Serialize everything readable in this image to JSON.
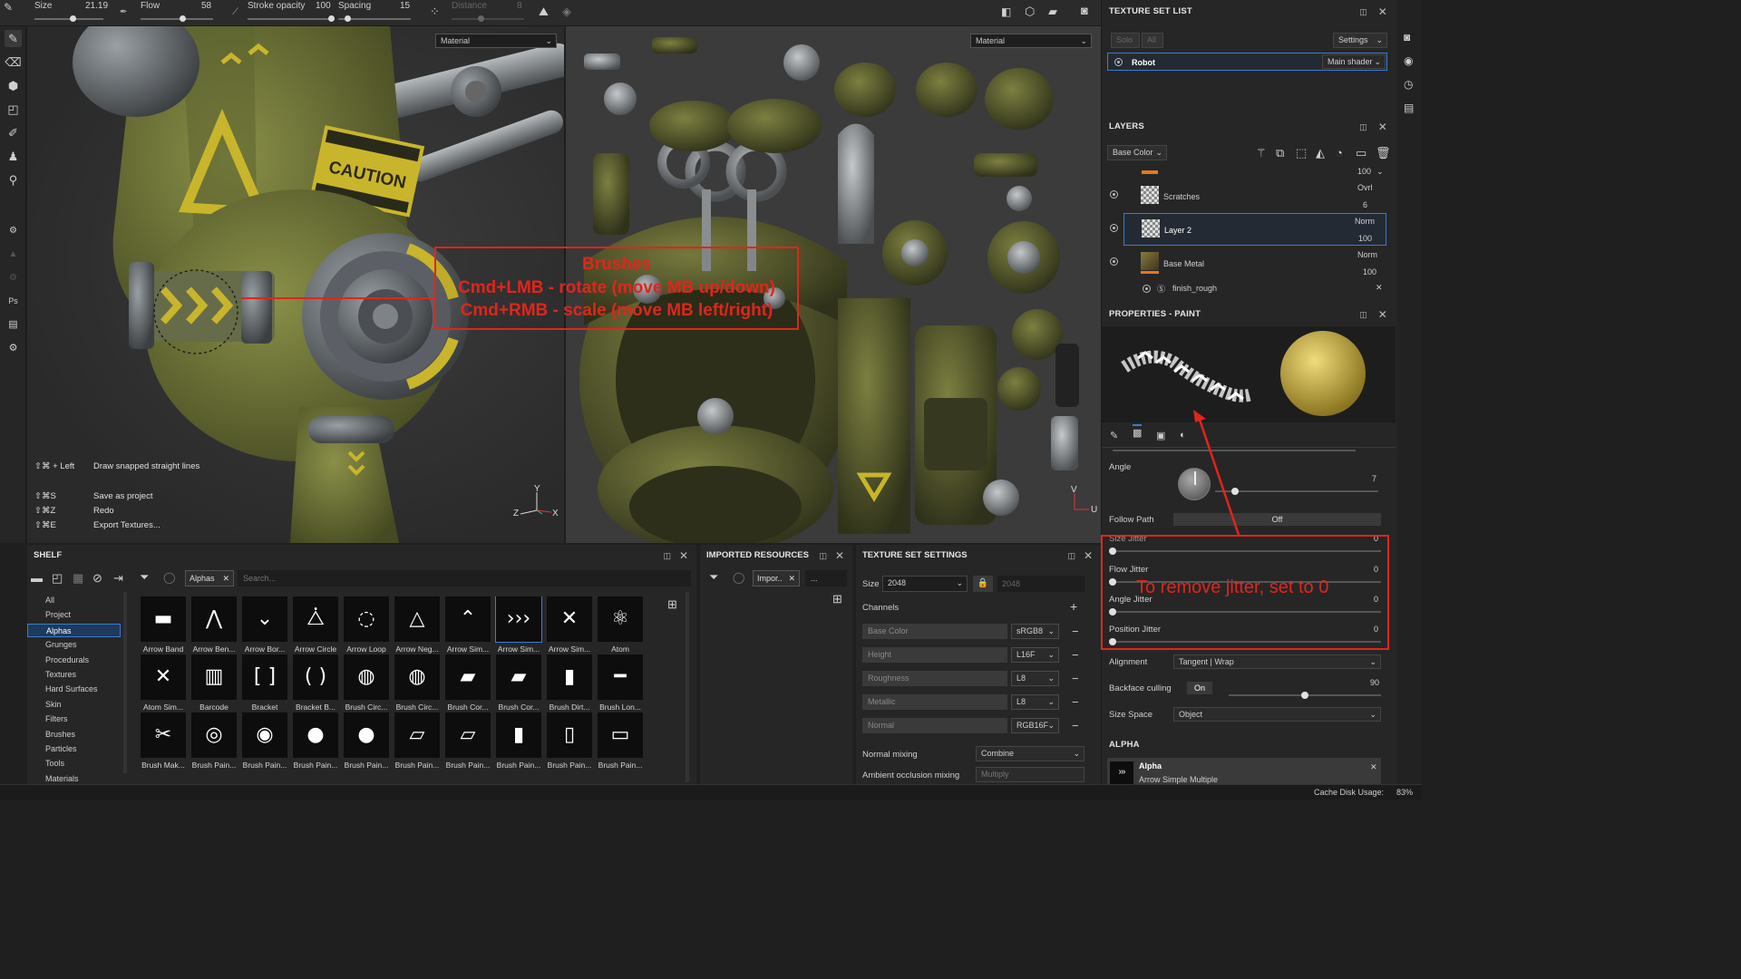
{
  "toolbar": {
    "size_label": "Size",
    "size_value": "21.19",
    "size_frac": 0.55,
    "flow_label": "Flow",
    "flow_value": "58",
    "flow_frac": 0.58,
    "stroke_opacity_label": "Stroke opacity",
    "stroke_opacity_value": "100",
    "stroke_opacity_frac": 1.0,
    "spacing_label": "Spacing",
    "spacing_value": "15",
    "spacing_frac": 0.12,
    "distance_label": "Distance",
    "distance_value": "8",
    "distance_frac": 0.4
  },
  "viewport3d": {
    "material_select": "Material",
    "shortcuts": [
      {
        "keys": "⇧⌘ + Left",
        "desc": "Draw snapped straight lines"
      },
      {
        "keys": "⇧⌘S",
        "desc": "Save as project"
      },
      {
        "keys": "⇧⌘Z",
        "desc": "Redo"
      },
      {
        "keys": "⇧⌘E",
        "desc": "Export Textures..."
      }
    ],
    "model_text": "CAUTION",
    "axis": {
      "y": "Y",
      "z": "Z",
      "x": "X"
    }
  },
  "viewport2d": {
    "material_select": "Material",
    "axis": {
      "v": "V",
      "u": "U"
    }
  },
  "annotation_brushes": {
    "title": "Brushes",
    "line1": "Cmd+LMB - rotate (move MB up/down)",
    "line2": "Cmd+RMB - scale (move MB left/right)"
  },
  "annotation_jitter": {
    "text": "To remove jitter, set to 0"
  },
  "texture_set_list": {
    "title": "TEXTURE SET LIST",
    "solo": "Solo",
    "all": "All",
    "settings": "Settings",
    "set_name": "Robot",
    "shader": "Main shader"
  },
  "layers": {
    "title": "LAYERS",
    "channel": "Base Color",
    "top_opacity": "100",
    "items": [
      {
        "name": "Scratches",
        "blend": "Ovrl",
        "opacity": "6"
      },
      {
        "name": "Layer 2",
        "blend": "Norm",
        "opacity": "100"
      },
      {
        "name": "Base Metal",
        "blend": "Norm",
        "opacity": "100"
      }
    ],
    "sub_item": "finish_rough"
  },
  "properties": {
    "title": "PROPERTIES - PAINT",
    "angle_label": "Angle",
    "angle_value": "7",
    "angle_frac": 0.12,
    "follow_path_label": "Follow Path",
    "follow_path_value": "Off",
    "jitters": [
      {
        "label": "Size Jitter",
        "value": "0"
      },
      {
        "label": "Flow Jitter",
        "value": "0"
      },
      {
        "label": "Angle Jitter",
        "value": "0"
      },
      {
        "label": "Position Jitter",
        "value": "0"
      }
    ],
    "alignment_label": "Alignment",
    "alignment_value": "Tangent | Wrap",
    "backface_label": "Backface culling",
    "backface_value": "On",
    "backface_num": "90",
    "backface_frac": 0.5,
    "size_space_label": "Size Space",
    "size_space_value": "Object",
    "alpha_header": "ALPHA",
    "alpha_name": "Alpha",
    "alpha_sub": "Arrow Simple Multiple"
  },
  "shelf": {
    "title": "SHELF",
    "filter_tag": "Alphas",
    "search_placeholder": "Search...",
    "categories": [
      "All",
      "Project",
      "Alphas",
      "Grunges",
      "Procedurals",
      "Textures",
      "Hard Surfaces",
      "Skin",
      "Filters",
      "Brushes",
      "Particles",
      "Tools",
      "Materials"
    ],
    "selected_category": "Alphas",
    "items": [
      "Arrow Band",
      "Arrow Ben...",
      "Arrow Bor...",
      "Arrow Circle",
      "Arrow Loop",
      "Arrow Neg...",
      "Arrow Sim...",
      "Arrow Sim...",
      "Arrow Sim...",
      "Atom",
      "Atom Sim...",
      "Barcode",
      "Bracket",
      "Bracket B...",
      "Brush Circ...",
      "Brush Circ...",
      "Brush Cor...",
      "Brush Cor...",
      "Brush Dirt...",
      "Brush Lon...",
      "Brush Mak...",
      "Brush Pain...",
      "Brush Pain...",
      "Brush Pain...",
      "Brush Pain...",
      "Brush Pain...",
      "Brush Pain...",
      "Brush Pain...",
      "Brush Pain...",
      "Brush Pain..."
    ],
    "selected_item_index": 7
  },
  "imported": {
    "title": "IMPORTED RESOURCES",
    "filter_tag": "Impor..",
    "more": "..."
  },
  "texture_set_settings": {
    "title": "TEXTURE SET SETTINGS",
    "size_label": "Size",
    "size_value": "2048",
    "size_locked_value": "2048",
    "channels_label": "Channels",
    "channels": [
      {
        "name": "Base Color",
        "format": "sRGB8"
      },
      {
        "name": "Height",
        "format": "L16F"
      },
      {
        "name": "Roughness",
        "format": "L8"
      },
      {
        "name": "Metallic",
        "format": "L8"
      },
      {
        "name": "Normal",
        "format": "RGB16F"
      }
    ],
    "normal_mixing_label": "Normal mixing",
    "normal_mixing_value": "Combine",
    "ao_mixing_label": "Ambient occlusion mixing",
    "ao_mixing_value": "Multiply"
  },
  "status": {
    "cache_label": "Cache Disk Usage:",
    "cache_value": "83%"
  },
  "colors": {
    "accent": "#3a7bd5",
    "annotation": "#e1251b",
    "model_yellow": "#c9b52b",
    "model_olive": "#6e7438"
  }
}
